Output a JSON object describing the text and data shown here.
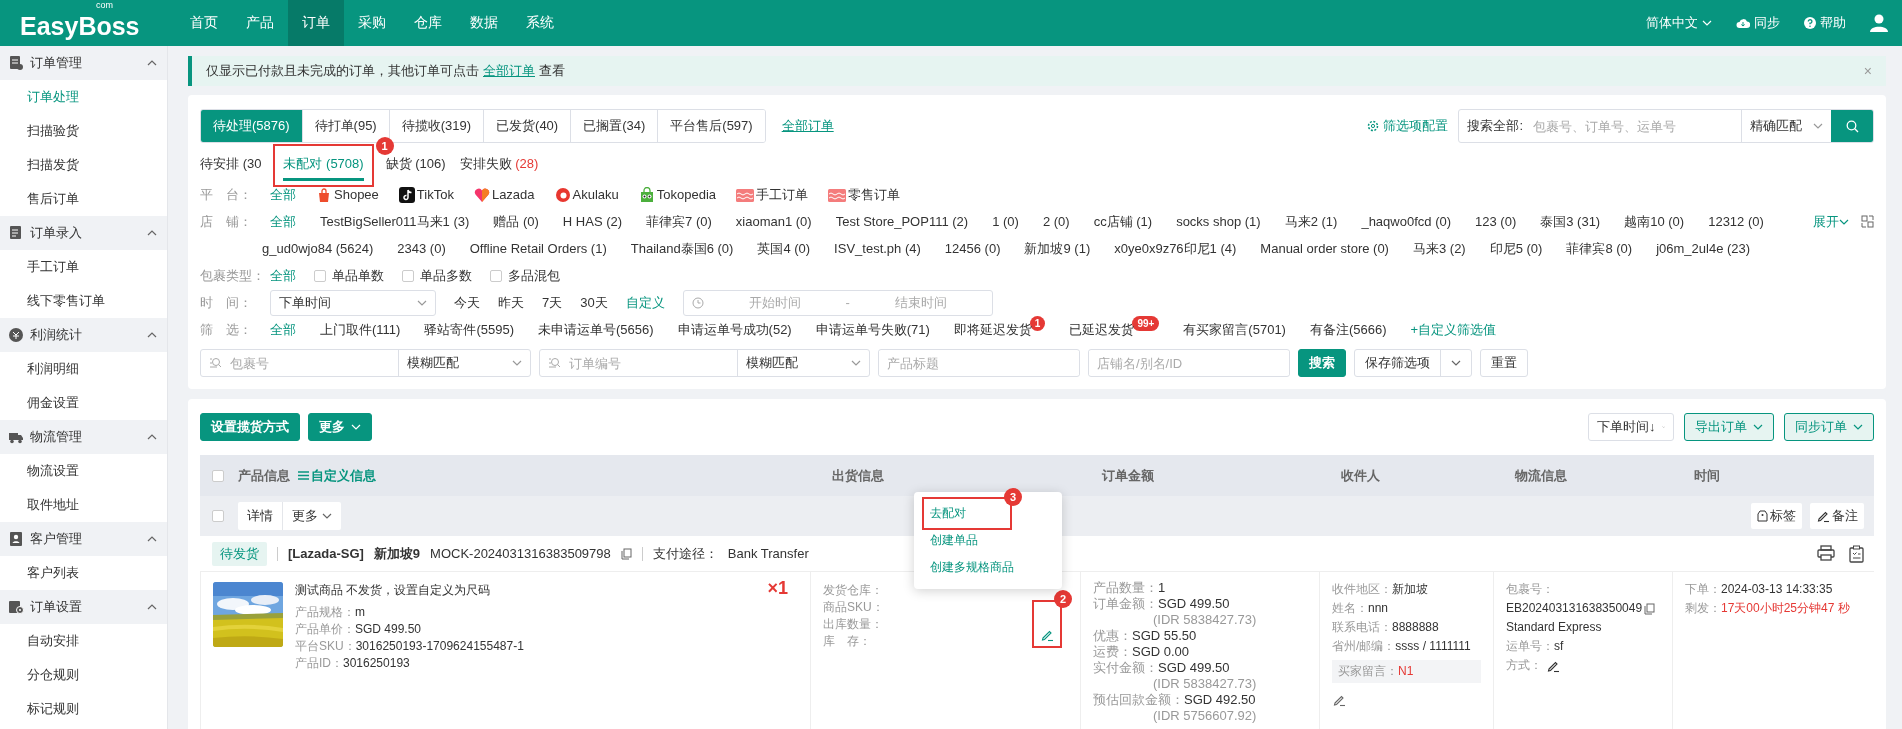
{
  "header": {
    "logo": "EasyBoss",
    "logo_sup": "com",
    "nav": [
      {
        "label": "首页",
        "selected": false
      },
      {
        "label": "产品",
        "selected": false
      },
      {
        "label": "订单",
        "selected": true
      },
      {
        "label": "采购",
        "selected": false
      },
      {
        "label": "仓库",
        "selected": false
      },
      {
        "label": "数据",
        "selected": false
      },
      {
        "label": "系统",
        "selected": false
      }
    ],
    "language": "简体中文",
    "sync": "同步",
    "help": "帮助"
  },
  "sidebar": {
    "groups": [
      {
        "title": "订单管理",
        "expanded": true,
        "items": [
          {
            "label": "订单处理",
            "selected": true
          },
          {
            "label": "扫描验货",
            "selected": false
          },
          {
            "label": "扫描发货",
            "selected": false
          },
          {
            "label": "售后订单",
            "selected": false
          }
        ]
      },
      {
        "title": "订单录入",
        "expanded": true,
        "items": [
          {
            "label": "手工订单",
            "selected": false
          },
          {
            "label": "线下零售订单",
            "selected": false
          }
        ]
      },
      {
        "title": "利润统计",
        "expanded": true,
        "items": [
          {
            "label": "利润明细",
            "selected": false
          },
          {
            "label": "佣金设置",
            "selected": false
          }
        ]
      },
      {
        "title": "物流管理",
        "expanded": true,
        "items": [
          {
            "label": "物流设置",
            "selected": false
          },
          {
            "label": "取件地址",
            "selected": false
          }
        ]
      },
      {
        "title": "客户管理",
        "expanded": true,
        "items": [
          {
            "label": "客户列表",
            "selected": false
          }
        ]
      },
      {
        "title": "订单设置",
        "expanded": true,
        "items": [
          {
            "label": "自动安排",
            "selected": false
          },
          {
            "label": "分仓规则",
            "selected": false
          },
          {
            "label": "标记规则",
            "selected": false
          }
        ]
      }
    ]
  },
  "notice": {
    "text": "仅显示已付款且未完成的订单，其他订单可点击",
    "link": "全部订单",
    "suffix": "查看",
    "close": "×"
  },
  "status_tabs": [
    {
      "label": "待处理(5876)",
      "selected": true
    },
    {
      "label": "待打单(95)",
      "selected": false
    },
    {
      "label": "待揽收(319)",
      "selected": false
    },
    {
      "label": "已发货(40)",
      "selected": false
    },
    {
      "label": "已搁置(34)",
      "selected": false
    },
    {
      "label": "平台售后(597)",
      "selected": false
    }
  ],
  "all_orders_link": "全部订单",
  "filter_config": "筛选项配置",
  "global_search": {
    "label": "搜索全部:",
    "placeholder": "包裹号、订单号、运单号",
    "match": "精确匹配"
  },
  "sub_tabs": [
    {
      "label": "待安排",
      "count": "(30",
      "selected": false,
      "alert": false
    },
    {
      "label": "未配对",
      "count": "(5708)",
      "selected": true,
      "alert": false,
      "annotation": "1"
    },
    {
      "label": "缺货",
      "count": "(106)",
      "selected": false,
      "alert": false
    },
    {
      "label": "安排失败",
      "count": "(28)",
      "selected": false,
      "alert": true
    }
  ],
  "filter_rows": [
    {
      "kind": "platform",
      "label": "平　台：",
      "all": {
        "label": "全部",
        "selected": true
      },
      "items": [
        {
          "label": "Shopee",
          "selected": false
        },
        {
          "label": "TikTok",
          "selected": false
        },
        {
          "label": "Lazada",
          "selected": false
        },
        {
          "label": "Akulaku",
          "selected": false
        },
        {
          "label": "Tokopedia",
          "selected": false
        },
        {
          "label": "手工订单",
          "selected": false
        },
        {
          "label": "零售订单",
          "selected": false
        }
      ]
    },
    {
      "kind": "store",
      "label": "店　铺：",
      "all": {
        "label": "全部",
        "selected": true
      },
      "expand": "展开",
      "lines": [
        [
          {
            "label": "TestBigSeller011马来1 (3)",
            "selected": false
          },
          {
            "label": "赠品 (0)",
            "selected": false
          },
          {
            "label": "H HAS (2)",
            "selected": false
          },
          {
            "label": "菲律宾7 (0)",
            "selected": false
          },
          {
            "label": "xiaoman1 (0)",
            "selected": false
          },
          {
            "label": "Test Store_POP111 (2)",
            "selected": false
          },
          {
            "label": "1 (0)",
            "selected": false
          },
          {
            "label": "2 (0)",
            "selected": false
          },
          {
            "label": "cc店铺 (1)",
            "selected": false
          },
          {
            "label": "socks shop (1)",
            "selected": false
          },
          {
            "label": "马来2 (1)",
            "selected": false
          },
          {
            "label": "_haqwo0fcd (0)",
            "selected": false
          },
          {
            "label": "123 (0)",
            "selected": false
          },
          {
            "label": "泰国3 (31)",
            "selected": false
          },
          {
            "label": "越南10 (0)",
            "selected": false
          },
          {
            "label": "12312 (0)",
            "selected": false
          }
        ],
        [
          {
            "label": "g_ud0wjo84 (5624)",
            "selected": false
          },
          {
            "label": "2343 (0)",
            "selected": false
          },
          {
            "label": "Offline Retail Orders (1)",
            "selected": false
          },
          {
            "label": "Thailand泰国6 (0)",
            "selected": false
          },
          {
            "label": "英国4 (0)",
            "selected": false
          },
          {
            "label": "ISV_test.ph (4)",
            "selected": false
          },
          {
            "label": "12456 (0)",
            "selected": false
          },
          {
            "label": "新加坡9 (1)",
            "selected": false
          },
          {
            "label": "x0ye0x9z76印尼1 (4)",
            "selected": false
          },
          {
            "label": "Manual order store (0)",
            "selected": false
          },
          {
            "label": "马来3 (2)",
            "selected": false
          },
          {
            "label": "印尼5 (0)",
            "selected": false
          },
          {
            "label": "菲律宾8 (0)",
            "selected": false
          },
          {
            "label": "j06m_2ul4e (23)",
            "selected": false
          }
        ]
      ]
    },
    {
      "kind": "package",
      "label": "包裹类型：",
      "all": {
        "label": "全部",
        "selected": true
      },
      "items": [
        {
          "label": "单品单数",
          "checked": false
        },
        {
          "label": "单品多数",
          "checked": false
        },
        {
          "label": "多品混包",
          "checked": false
        }
      ]
    },
    {
      "kind": "time",
      "label": "时　间：",
      "select": "下单时间",
      "items": [
        {
          "label": "今天",
          "kind": "text"
        },
        {
          "label": "昨天",
          "kind": "text"
        },
        {
          "label": "7天",
          "kind": "text"
        },
        {
          "label": "30天",
          "kind": "text"
        },
        {
          "label": "自定义",
          "kind": "link"
        }
      ],
      "range": {
        "start": "开始时间",
        "separator": "-",
        "end": "结束时间"
      }
    },
    {
      "kind": "filter",
      "label": "筛　选：",
      "all": {
        "label": "全部",
        "selected": true
      },
      "items": [
        {
          "label": "上门取件(111)",
          "selected": false
        },
        {
          "label": "驿站寄件(5595)",
          "selected": false
        },
        {
          "label": "未申请运单号(5656)",
          "selected": false
        },
        {
          "label": "申请运单号成功(52)",
          "selected": false
        },
        {
          "label": "申请运单号失败(71)",
          "selected": false
        },
        {
          "label": "即将延迟发货",
          "selected": false,
          "badge": "1"
        },
        {
          "label": "已延迟发货",
          "selected": false,
          "badge": "99+"
        },
        {
          "label": "有买家留言(5701)",
          "selected": false
        },
        {
          "label": "有备注(5666)",
          "selected": false
        }
      ],
      "custom_link": "+自定义筛选值"
    }
  ],
  "search_fields": [
    {
      "placeholder": "包裹号",
      "match": "模糊匹配"
    },
    {
      "placeholder": "订单编号",
      "match": "模糊匹配"
    },
    {
      "placeholder": "产品标题"
    },
    {
      "placeholder": "店铺名/别名/ID"
    }
  ],
  "search_button": "搜索",
  "save_filter": "保存筛选项",
  "reset": "重置",
  "toolbar": {
    "left": [
      {
        "label": "设置揽货方式",
        "caret": false
      },
      {
        "label": "更多",
        "caret": true
      }
    ],
    "sort": "下单时间↓",
    "right": [
      {
        "label": "导出订单"
      },
      {
        "label": "同步订单"
      }
    ]
  },
  "columns": [
    "产品信息",
    "出货信息",
    "订单金额",
    "收件人",
    "物流信息",
    "时间"
  ],
  "custom_info": "自定义信息",
  "select_all_checked": false,
  "bulk": {
    "checked": false,
    "detail": "详情",
    "more": "更多",
    "tag": "标签",
    "remark": "备注"
  },
  "order": {
    "status": "待发货",
    "platform": "[Lazada-SG]",
    "store": "新加坡9",
    "order_no": "MOCK-2024031316383509798",
    "payment_label": "支付途径：",
    "payment": "Bank Transfer",
    "product": {
      "name": "测试商品 不发货，设置自定义为尺码",
      "specs": [
        {
          "label": "产品规格：",
          "value": "m"
        },
        {
          "label": "产品单价：",
          "value": "SGD 499.50"
        },
        {
          "label": "平台SKU：",
          "value": "3016250193-1709624155487-1"
        },
        {
          "label": "产品ID：",
          "value": "3016250193"
        }
      ],
      "quantity": "×1"
    },
    "shipping": {
      "labels": [
        "发货仓库：",
        "商品SKU：",
        "出库数量：",
        "库　存："
      ],
      "edit_annotation": "2",
      "menu": [
        {
          "label": "去配对",
          "annotation": "3"
        },
        {
          "label": "创建单品"
        },
        {
          "label": "创建多规格商品"
        }
      ]
    },
    "amount": [
      {
        "label": "产品数量：",
        "value": "1"
      },
      {
        "label": "订单金额：",
        "value": "SGD 499.50"
      },
      {
        "note": "(IDR 5838427.73)"
      },
      {
        "label": "优惠：",
        "value": "SGD 55.50"
      },
      {
        "label": "运费：",
        "value": "SGD 0.00"
      },
      {
        "label": "实付金额：",
        "value": "SGD 499.50"
      },
      {
        "note": "(IDR 5838427.73)"
      },
      {
        "label": "预估回款金额：",
        "value": "SGD 492.50"
      },
      {
        "note": "(IDR 5756607.92)"
      }
    ],
    "recipient": [
      {
        "label": "收件地区：",
        "value": "新加坡"
      },
      {
        "label": "姓名：",
        "value": "nnn"
      },
      {
        "label": "联系电话：",
        "value": "8888888"
      },
      {
        "label": "省州/邮编：",
        "value": "ssss / 1111111"
      }
    ],
    "buyer_message": {
      "label": "买家留言：",
      "value": "N1"
    },
    "logistics": {
      "package_label": "包裹号：",
      "package_no": "EB202403131638350049",
      "service": "Standard Express",
      "waybill_label": "运单号：",
      "waybill": "sf",
      "method_label": "方式："
    },
    "time": [
      {
        "label": "下单：",
        "value": "2024-03-13 14:33:35",
        "alert": false
      },
      {
        "label": "剩发：",
        "value": "17天00小时25分钟47 秒",
        "alert": true
      }
    ]
  }
}
